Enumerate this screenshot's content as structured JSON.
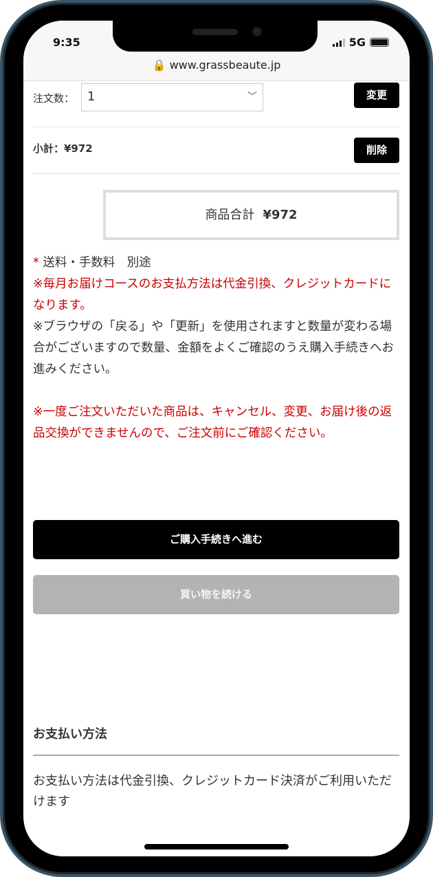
{
  "status_bar": {
    "time": "9:35",
    "network": "5G"
  },
  "browser": {
    "url": "www.grassbeaute.jp"
  },
  "cart": {
    "quantity_label": "注文数：",
    "quantity_value": "1",
    "change_label": "変更",
    "subtotal": "小計：¥972",
    "delete_label": "削除",
    "total_label": "商品合計",
    "total_value": "¥972"
  },
  "notes": {
    "shipping_asterisk": "*",
    "shipping": " 送料・手数料　別途",
    "note1": "※毎月お届けコースのお支払方法は代金引換、クレジットカードになります。",
    "note2": "※ブラウザの「戻る」や「更新」を使用されますと数量が変わる場合がございますので数量、金額をよくご確認のうえ購入手続きへお進みください。",
    "note3": "※一度ご注文いただいた商品は、キャンセル、変更、お届け後の返品交換ができませんので、ご注文前にご確認ください。"
  },
  "buttons": {
    "checkout": "ご購入手続きへ進む",
    "continue": "買い物を続ける"
  },
  "payment": {
    "heading": "お支払い方法",
    "text": "お支払い方法は代金引換、クレジットカード決済がご利用いただけます"
  },
  "colors": {
    "accent_red": "#cc0000",
    "button_black": "#000000",
    "button_gray": "#b3b3b3"
  }
}
